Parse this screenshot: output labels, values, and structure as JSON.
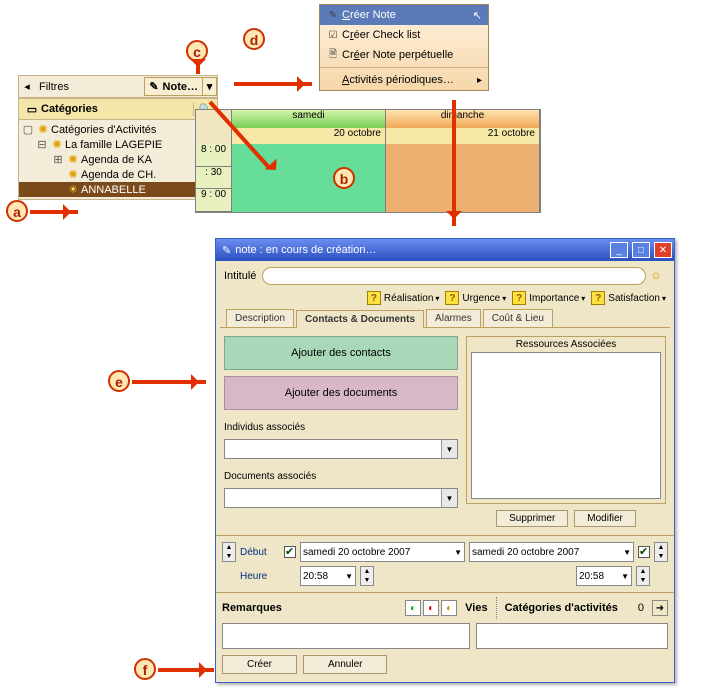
{
  "sidebar": {
    "filters_label": "Filtres",
    "note_button": "Note…",
    "categories_header": "Catégories",
    "tree": {
      "root": "Catégories d'Activités",
      "family": "La famille LAGEPIE",
      "child1": "Agenda  de KA",
      "child2": "Agenda de CH.",
      "selected": "ANNABELLE"
    }
  },
  "ctx_menu": {
    "create_note": "Créer Note",
    "create_checklist": "Créer Check list",
    "create_perpetual": "Créer Note perpétuelle",
    "periodic": "Activités périodiques…"
  },
  "calendar": {
    "day_sat": "samedi",
    "day_sun": "dimanche",
    "date_sat": "20 octobre",
    "date_sun": "21 octobre",
    "slot1": "8 : 00",
    "slot2": ": 30",
    "slot3": "9 : 00"
  },
  "note_window": {
    "title": "note : en cours de création…",
    "intitule_label": "Intitulé",
    "attrs": {
      "realisation": "Réalisation",
      "urgence": "Urgence",
      "importance": "Importance",
      "satisfaction": "Satisfaction"
    },
    "tabs": {
      "description": "Description",
      "contacts": "Contacts & Documents",
      "alarmes": "Alarmes",
      "cout": "Coût & Lieu"
    },
    "buttons": {
      "add_contacts": "Ajouter des contacts",
      "add_documents": "Ajouter des documents",
      "supprimer": "Supprimer",
      "modifier": "Modifier",
      "creer": "Créer",
      "annuler": "Annuler"
    },
    "labels": {
      "individus": "Individus associés",
      "documents": "Documents associés",
      "ressources": "Ressources Associées",
      "debut": "Début",
      "heure": "Heure",
      "remarques": "Remarques",
      "vies": "Vies",
      "categories": "Catégories d'activités",
      "cat_count": "0"
    },
    "dates": {
      "start": "samedi  20  octobre   2007",
      "end": "samedi  20  octobre   2007",
      "time": "20:58"
    }
  },
  "callouts": {
    "a": "a",
    "b": "b",
    "c": "c",
    "d": "d",
    "e": "e",
    "f": "f"
  }
}
